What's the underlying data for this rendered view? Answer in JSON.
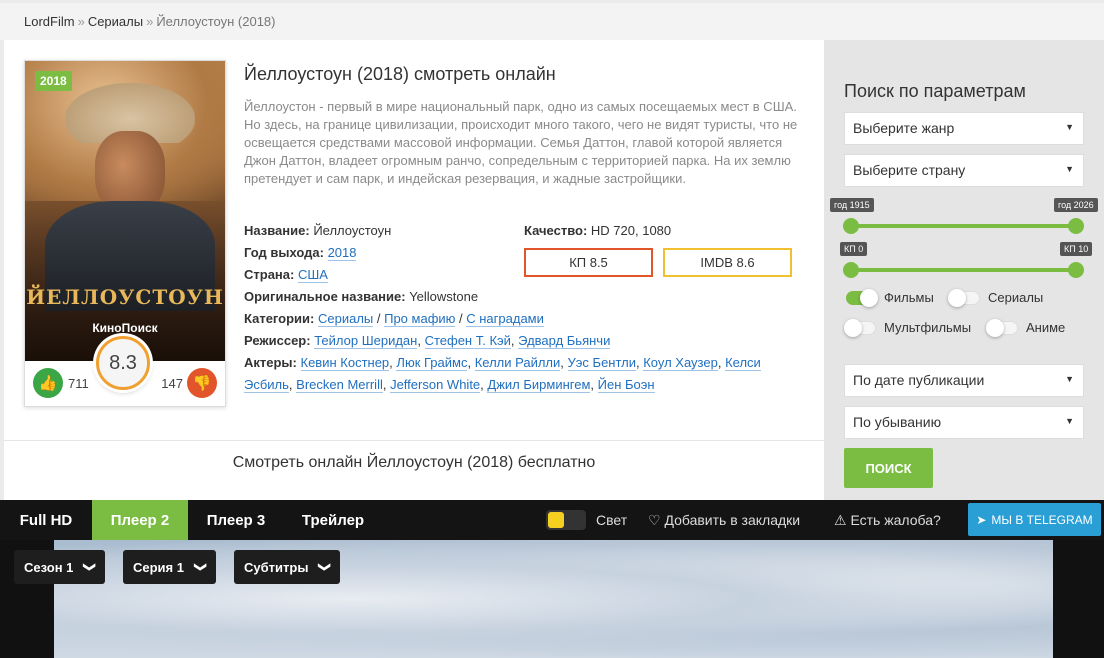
{
  "breadcrumb": {
    "home": "LordFilm",
    "section": "Сериалы",
    "current": "Йеллоустоун (2018)"
  },
  "film": {
    "title": "Йеллоустоун (2018) смотреть онлайн",
    "poster_title": "ЙЕЛЛОУСТОУН",
    "poster_brand": "КиноПоиск",
    "year_badge": "2018",
    "rating": "8.3",
    "likes": "711",
    "dislikes": "147",
    "description": "Йеллоустон - первый в мире национальный парк, одно из самых посещаемых мест в США. Но здесь, на границе цивилизации, происходит много такого, чего не видят туристы, что не освещается средствами массовой информации. Семья Даттон, главой которой является Джон Даттон, владеет огромным ранчо, сопредельным с территорией парка. На их землю претендует и сам парк, и индейская резервация, и жадные застройщики.",
    "name_label": "Название:",
    "name_value": "Йеллоустоун",
    "year_label": "Год выхода:",
    "year_value": "2018",
    "country_label": "Страна:",
    "country_value": "США",
    "orig_label": "Оригинальное название:",
    "orig_value": "Yellowstone",
    "cat_label": "Категории:",
    "categories": [
      "Сериалы",
      "Про мафию",
      "С наградами"
    ],
    "director_label": "Режиссер:",
    "directors": [
      "Тейлор Шеридан",
      "Стефен Т. Кэй",
      "Эдвард Бьянчи"
    ],
    "actors_label": "Актеры:",
    "actors": [
      "Кевин Костнер",
      "Люк Граймс",
      "Келли Райлли",
      "Уэс Бентли",
      "Коул Хаузер",
      "Келси Эсбиль",
      "Brecken Merrill",
      "Jefferson White",
      "Джил Бирмингем",
      "Йен Боэн"
    ],
    "quality_label": "Качество:",
    "quality_value": "HD 720, 1080",
    "kp": "КП 8.5",
    "imdb": "IMDB 8.6",
    "watch_free": "Смотреть онлайн Йеллоустоун (2018) бесплатно"
  },
  "sidebar": {
    "title": "Поиск по параметрам",
    "genre_placeholder": "Выберите жанр",
    "country_placeholder": "Выберите страну",
    "year_from": "год 1915",
    "year_to": "год 2026",
    "kp_from": "КП 0",
    "kp_to": "КП 10",
    "toggles": {
      "films": "Фильмы",
      "series": "Сериалы",
      "cartoons": "Мультфильмы",
      "anime": "Аниме"
    },
    "sort_by": "По дате публикации",
    "order": "По убыванию",
    "search_button": "ПОИСК"
  },
  "player": {
    "tabs": [
      "Full HD",
      "Плеер 2",
      "Плеер 3",
      "Трейлер"
    ],
    "active_tab": "Плеер 2",
    "light": "Свет",
    "bookmark": "Добавить в закладки",
    "complaint": "Есть жалоба?",
    "telegram": "МЫ В TELEGRAM",
    "season": "Сезон 1",
    "episode": "Серия 1",
    "subtitles": "Субтитры"
  },
  "colors": {
    "accent_green": "#7bbd42",
    "kp_red": "#e2552a",
    "imdb_yellow": "#f0c030",
    "link_blue": "#1f6fbf",
    "telegram_blue": "#2a9fd6"
  }
}
